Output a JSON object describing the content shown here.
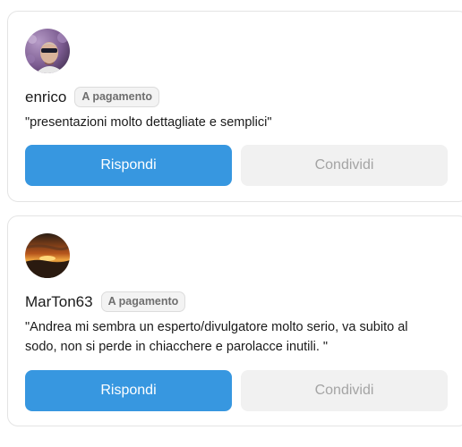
{
  "comments": [
    {
      "username": "enrico",
      "badge": "A pagamento",
      "text": "\"presentazioni molto dettagliate e semplici\"",
      "reply_label": "Rispondi",
      "share_label": "Condividi"
    },
    {
      "username": "MarTon63",
      "badge": "A pagamento",
      "text": "\"Andrea mi sembra un esperto/divulgatore molto serio, va subito al sodo, non si perde in chiacchere e parolacce inutili. \"",
      "reply_label": "Rispondi",
      "share_label": "Condividi"
    }
  ],
  "colors": {
    "reply_button": "#3797e0",
    "share_button": "#f1f1f1",
    "badge_bg": "#f3f3f3"
  }
}
